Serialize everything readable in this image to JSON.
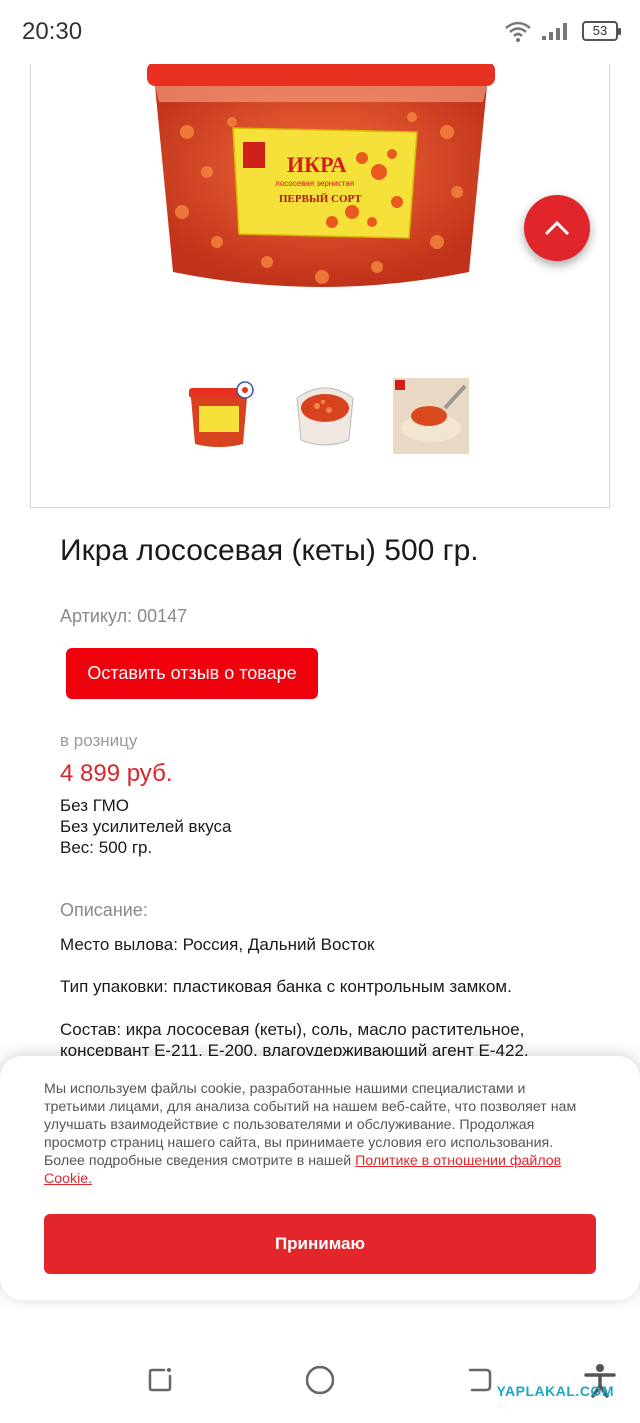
{
  "status_bar": {
    "time": "20:30",
    "battery": "53"
  },
  "gallery": {
    "main_image_label": {
      "title": "ИКРА",
      "subtitle": "лососевая зернистая",
      "grade": "ПЕРВЫЙ СОРТ"
    },
    "thumbnails": [
      "jar-front",
      "jar-top",
      "spoon-serving"
    ]
  },
  "product": {
    "title": "Икра лососевая (кеты) 500 гр.",
    "article": "Артикул: 00147",
    "review_button": "Оставить отзыв о товаре",
    "retail_label": "в розницу",
    "price": "4 899 руб.",
    "features": [
      "Без ГМО",
      "Без усилителей вкуса",
      "Вес: 500 гр."
    ],
    "description_label": "Описание:",
    "description": [
      "Место вылова: Россия, Дальний Восток",
      "Тип упаковки: пластиковая банка с контрольным замком.",
      "Состав: икра лососевая (кеты), соль, масло растительное,",
      "консервант Е-211, Е-200, влагоудерживающий агент Е-422."
    ]
  },
  "cookie": {
    "text": "Мы используем файлы cookie, разработанные нашими специалистами и третьими лицами, для анализа событий на нашем веб-сайте, что позволяет нам улучшать взаимодействие с пользователями и обслуживание. Продолжая просмотр страниц нашего сайта, вы принимаете условия его использования. Более подробные сведения смотрите в нашей ",
    "link": "Политике в отношении файлов Cookie.",
    "accept": "Принимаю"
  },
  "watermark": "YAPLAKAL.COM",
  "colors": {
    "accent": "#e2262c",
    "button": "#f0000d",
    "price": "#d9262c"
  }
}
